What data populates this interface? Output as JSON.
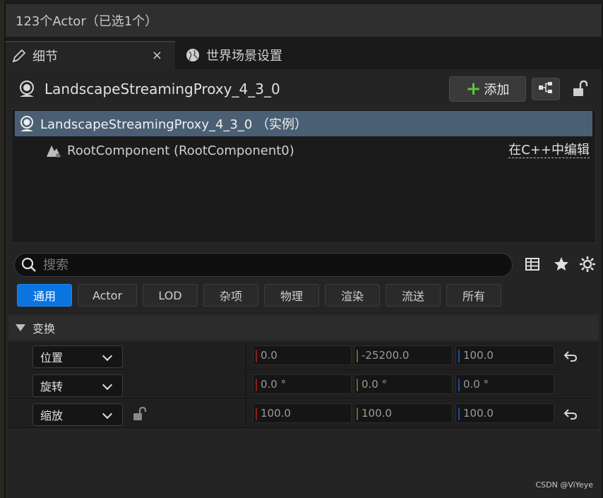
{
  "selection_header": {
    "text": "123个Actor（已选1个）"
  },
  "tabs": [
    {
      "label": "细节",
      "icon": "pencil-icon",
      "active": true,
      "close": "×"
    },
    {
      "label": "世界场景设置",
      "icon": "globe-icon",
      "active": false
    }
  ],
  "actor": {
    "name": "LandscapeStreamingProxy_4_3_0",
    "add_label": "添加",
    "add_icon": "plus-icon"
  },
  "tree": {
    "root_label": "LandscapeStreamingProxy_4_3_0 （实例）",
    "child_label": "RootComponent (RootComponent0)",
    "edit_link": "在C++中编辑"
  },
  "search": {
    "placeholder": "搜索"
  },
  "filters": [
    "通用",
    "Actor",
    "LOD",
    "杂项",
    "物理",
    "渲染",
    "流送",
    "所有"
  ],
  "active_filter": "通用",
  "section": {
    "label": "变换"
  },
  "transform": [
    {
      "label": "位置",
      "x": "0.0",
      "y": "-25200.0",
      "z": "100.0",
      "reset": true,
      "lock": false
    },
    {
      "label": "旋转",
      "x": "0.0 °",
      "y": "0.0 °",
      "z": "0.0 °",
      "reset": false,
      "lock": false
    },
    {
      "label": "缩放",
      "x": "100.0",
      "y": "100.0",
      "z": "100.0",
      "reset": true,
      "lock": true
    }
  ],
  "watermark": "CSDN @ViYeye",
  "colors": {
    "accent": "#0a74e0",
    "selection": "#4a5f73",
    "add_plus": "#5fc33c"
  }
}
